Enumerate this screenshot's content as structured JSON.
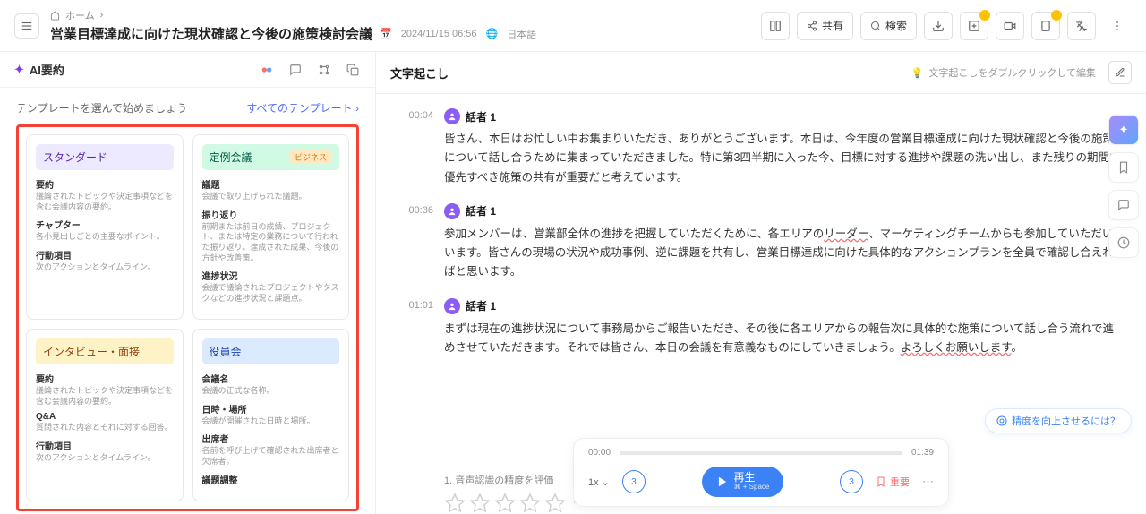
{
  "header": {
    "home": "ホーム",
    "title": "営業目標達成に向けた現状確認と今後の施策検討会議",
    "datetime": "2024/11/15 06:56",
    "language": "日本語",
    "share": "共有",
    "search": "検索"
  },
  "left": {
    "title": "AI要約",
    "template_prompt": "テンプレートを選んで始めましょう",
    "all_templates": "すべてのテンプレート",
    "business_badge": "ビジネス",
    "cards": [
      {
        "title": "スタンダード",
        "sections": [
          {
            "t": "要約",
            "d": "議論されたトピックや決定事項などを含む会議内容の要約。"
          },
          {
            "t": "チャプター",
            "d": "各小見出しごとの主要なポイント。"
          },
          {
            "t": "行動項目",
            "d": "次のアクションとタイムライン。"
          }
        ]
      },
      {
        "title": "定例会議",
        "sections": [
          {
            "t": "議題",
            "d": "会議で取り上げられた議題。"
          },
          {
            "t": "振り返り",
            "d": "前期または前日の成績、プロジェクト、または特定の業務について行われた振り返り。達成された成果、今後の方針や改善策。"
          },
          {
            "t": "進捗状況",
            "d": "会議で議論されたプロジェクトやタスクなどの進捗状況と課題点。"
          }
        ]
      },
      {
        "title": "インタビュー・面接",
        "sections": [
          {
            "t": "要約",
            "d": "議論されたトピックや決定事項などを含む会議内容の要約。"
          },
          {
            "t": "Q&A",
            "d": "質問された内容とそれに対する回答。"
          },
          {
            "t": "行動項目",
            "d": "次のアクションとタイムライン。"
          }
        ]
      },
      {
        "title": "役員会",
        "sections": [
          {
            "t": "会議名",
            "d": "会議の正式な名称。"
          },
          {
            "t": "日時・場所",
            "d": "会議が開催された日時と場所。"
          },
          {
            "t": "出席者",
            "d": "名前を呼び上げて確認された出席者と欠席者。"
          },
          {
            "t": "議題調整",
            "d": ""
          }
        ]
      }
    ]
  },
  "right": {
    "title": "文字起こし",
    "hint": "文字起こしをダブルクリックして編集",
    "entries": [
      {
        "ts": "00:04",
        "speaker": "話者 1",
        "text": "皆さん、本日はお忙しい中お集まりいただき、ありがとうございます。本日は、今年度の営業目標達成に向けた現状確認と今後の施策について話し合うために集まっていただきました。特に第3四半期に入った今、目標に対する進捗や課題の洗い出し、また残りの期間で優先すべき施策の共有が重要だと考えています。"
      },
      {
        "ts": "00:36",
        "speaker": "話者 1",
        "text": "参加メンバーは、営業部全体の進捗を把握していただくために、各エリアのリーダー、マーケティングチームからも参加していただいています。皆さんの現場の状況や成功事例、逆に課題を共有し、営業目標達成に向けた具体的なアクションプランを全員で確認し合えればと思います。"
      },
      {
        "ts": "01:01",
        "speaker": "話者 1",
        "text": "まずは現在の進捗状況について事務局からご報告いただき、その後に各エリアからの報告次に具体的な施策について話し合う流れで進めさせていただきます。それでは皆さん、本日の会議を有意義なものにしていきましょう。よろしくお願いします。"
      }
    ],
    "rating_label": "1. 音声認識の精度を評価"
  },
  "player": {
    "cur": "00:00",
    "dur": "01:39",
    "speed": "1x",
    "skip": "3",
    "play": "再生",
    "play_sub": "⌘ + Space",
    "important": "重要"
  },
  "help": "精度を向上させるには？"
}
